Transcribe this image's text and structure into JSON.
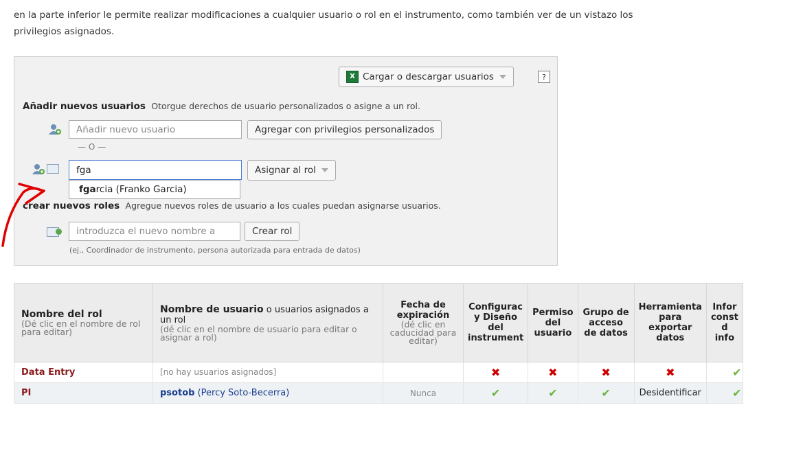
{
  "intro": {
    "line1": "en la parte inferior le permite realizar modificaciones a cualquier usuario o rol en el instrumento, como también ver de un vistazo los",
    "line2": "privilegios asignados."
  },
  "panel": {
    "upload_button": "Cargar o descargar usuarios",
    "help_button": "?",
    "add_users_title": "Añadir nuevos usuarios",
    "add_users_desc": "Otorgue derechos de usuario personalizados o asigne a un rol.",
    "new_user_placeholder": "Añadir nuevo usuario",
    "custom_privileges_button": "Agregar con privilegios personalizados",
    "or_divider": "— O —",
    "assign_input_value": "fga",
    "assign_role_button": "Asignar al rol",
    "suggestion_match": "fga",
    "suggestion_rest": "rcia (Franko Garcia)",
    "create_roles_title": "crear nuevos roles",
    "create_roles_desc": "Agregue nuevos roles de usuario a los cuales puedan asignarse usuarios.",
    "new_role_placeholder": "introduzca el nuevo nombre a",
    "create_role_button": "Crear rol",
    "role_example": "(ej., Coordinador de instrumento, persona autorizada para entrada de datos)"
  },
  "table": {
    "headers": {
      "role_name": "Nombre del rol",
      "role_name_sub": "(Dé clic en el nombre de rol para editar)",
      "username_bold": "Nombre de usuario",
      "username_rest": " o usuarios asignados a un rol",
      "username_sub": "(dé clic en el nombre de usuario para editar o asignar a rol)",
      "expiration": "Fecha de expiración",
      "expiration_sub": "(dé clic en caducidad para editar)",
      "config": "Configurac y Diseño del instrument",
      "permissions": "Permiso del usuario",
      "dag": "Grupo de acceso de datos",
      "export": "Herramienta para exportar datos",
      "reports": "Infor const d info"
    },
    "rows": [
      {
        "role": "Data Entry",
        "user_main": "[no hay usuarios asignados]",
        "user_extra": "",
        "expiration": "",
        "config": "x",
        "perm": "x",
        "dag": "x",
        "export": "x"
      },
      {
        "role": "PI",
        "user_main": "psotob",
        "user_extra": " (Percy Soto-Becerra)",
        "expiration": "Nunca",
        "config": "check",
        "perm": "check",
        "dag": "check",
        "export": "Desidentificar"
      }
    ]
  },
  "glyphs": {
    "x": "✖",
    "check": "✔"
  },
  "colors": {
    "role_link": "#8b1a1a",
    "user_link": "#1a3d8f",
    "x_mark": "#cc0000",
    "check": "#6cb33f",
    "annotation": "#e00000"
  }
}
